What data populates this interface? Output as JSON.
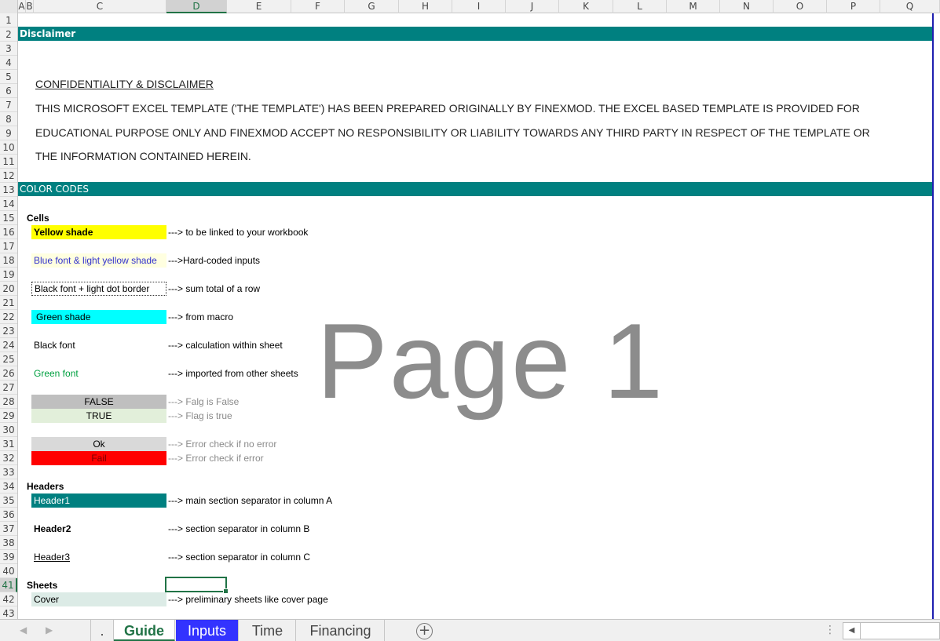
{
  "columns": [
    "A",
    "B",
    "C",
    "D",
    "E",
    "F",
    "G",
    "H",
    "I",
    "J",
    "K",
    "L",
    "M",
    "N",
    "O",
    "P",
    "Q"
  ],
  "selected_column": "D",
  "rows": [
    "1",
    "2",
    "3",
    "4",
    "5",
    "6",
    "7",
    "8",
    "9",
    "10",
    "11",
    "12",
    "13",
    "14",
    "15",
    "16",
    "17",
    "18",
    "19",
    "20",
    "21",
    "22",
    "23",
    "24",
    "25",
    "26",
    "27",
    "28",
    "29",
    "30",
    "31",
    "32",
    "33",
    "34",
    "35",
    "36",
    "37",
    "38",
    "39",
    "40",
    "41",
    "42",
    "43"
  ],
  "selected_row": "41",
  "disclaimer": {
    "header": "Disclaimer",
    "title": "CONFIDENTIALITY & DISCLAIMER",
    "line1": "THIS MICROSOFT EXCEL TEMPLATE  ('THE TEMPLATE') HAS BEEN PREPARED  ORIGINALLY BY FINEXMOD.  THE EXCEL BASED TEMPLATE IS PROVIDED FOR",
    "line2": "EDUCATIONAL PURPOSE ONLY AND FINEXMOD ACCEPT NO RESPONSIBILITY OR LIABILITY TOWARDS ANY THIRD PARTY IN RESPECT OF THE TEMPLATE OR",
    "line3": "THE INFORMATION CONTAINED HEREIN."
  },
  "color_codes": {
    "header": "COLOR CODES",
    "cells_label": "Cells",
    "items": [
      {
        "label": "Yellow shade",
        "desc": "---> to be linked to your workbook"
      },
      {
        "label": "Blue font & light yellow shade",
        "desc": "--->Hard-coded inputs"
      },
      {
        "label": "Black font + light dot border",
        "desc": "---> sum total of a row"
      },
      {
        "label": "Green shade",
        "desc": "---> from macro"
      },
      {
        "label": "Black font",
        "desc": "---> calculation within sheet"
      },
      {
        "label": "Green font",
        "desc": "---> imported from other sheets"
      },
      {
        "label": "FALSE",
        "desc": "---> Falg is False"
      },
      {
        "label": "TRUE",
        "desc": "---> Flag is true"
      },
      {
        "label": "Ok",
        "desc": "---> Error check if no error"
      },
      {
        "label": "Fail",
        "desc": "---> Error check if error"
      }
    ],
    "headers_label": "Headers",
    "header_items": [
      {
        "label": "Header1",
        "desc": "---> main section separator in column A"
      },
      {
        "label": "Header2",
        "desc": "---> section separator in column B"
      },
      {
        "label": "Header3",
        "desc": "---> section separator in column C"
      }
    ],
    "sheets_label": "Sheets",
    "sheet_items": [
      {
        "label": "Cover",
        "desc": "---> preliminary sheets like cover page"
      }
    ]
  },
  "watermark": "Page 1",
  "colors": {
    "teal_band": "#008080",
    "yellow": "#ffff00",
    "light_yellow": "#ffffe0",
    "cyan": "#00ffff",
    "green_font": "#00a040",
    "grey": "#bfbfbf",
    "light_green": "#e2efda",
    "red": "#ff0000",
    "tab_blue": "#3333ff",
    "excel_green": "#217346"
  },
  "tabs": [
    {
      "label": "."
    },
    {
      "label": "Guide"
    },
    {
      "label": "Inputs"
    },
    {
      "label": "Time"
    },
    {
      "label": "Financing"
    }
  ],
  "active_tab": "Guide",
  "icons": {
    "prev_sheet": "chevron-left-icon",
    "next_sheet": "chevron-right-icon",
    "add_sheet": "plus-circle-icon",
    "scroll_left": "caret-left-icon"
  }
}
